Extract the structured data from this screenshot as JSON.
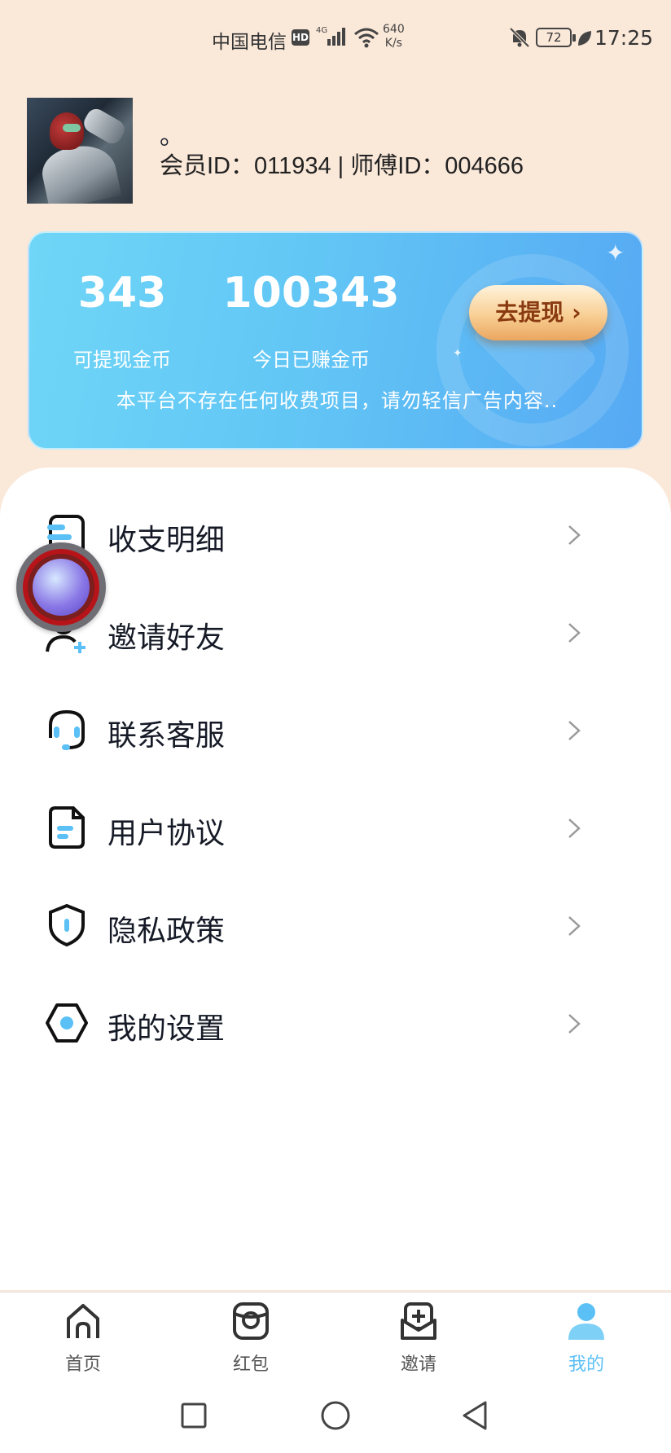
{
  "status_bar": {
    "carrier": "中国电信",
    "hd": "HD",
    "network": "4G",
    "speed_value": "640",
    "speed_unit": "K/s",
    "battery": "72",
    "time": "17:25"
  },
  "profile": {
    "nickname": "。",
    "member_line": "会员ID：011934 | 师傅ID：004666"
  },
  "balance": {
    "withdrawable_coins": "343",
    "withdrawable_label": "可提现金币",
    "today_coins": "100343",
    "today_label": "今日已赚金币",
    "withdraw_button": "去提现 ›",
    "notice": "本平台不存在任何收费项目，请勿轻信广告内容.."
  },
  "menu": {
    "items": [
      {
        "label": "收支明细",
        "icon": "ledger-icon"
      },
      {
        "label": "邀请好友",
        "icon": "invite-user-icon"
      },
      {
        "label": "联系客服",
        "icon": "headset-icon"
      },
      {
        "label": "用户协议",
        "icon": "document-icon"
      },
      {
        "label": "隐私政策",
        "icon": "shield-icon"
      },
      {
        "label": "我的设置",
        "icon": "settings-hexagon-icon"
      }
    ]
  },
  "bottom_nav": {
    "items": [
      {
        "label": "首页",
        "icon": "home-icon"
      },
      {
        "label": "红包",
        "icon": "red-packet-icon"
      },
      {
        "label": "邀请",
        "icon": "invite-icon"
      },
      {
        "label": "我的",
        "icon": "profile-icon",
        "active": true
      }
    ]
  },
  "colors": {
    "page_bg": "#fae8d9",
    "accent": "#5bc0f5",
    "card_start": "#6fd6f7",
    "card_end": "#56a9f3"
  }
}
